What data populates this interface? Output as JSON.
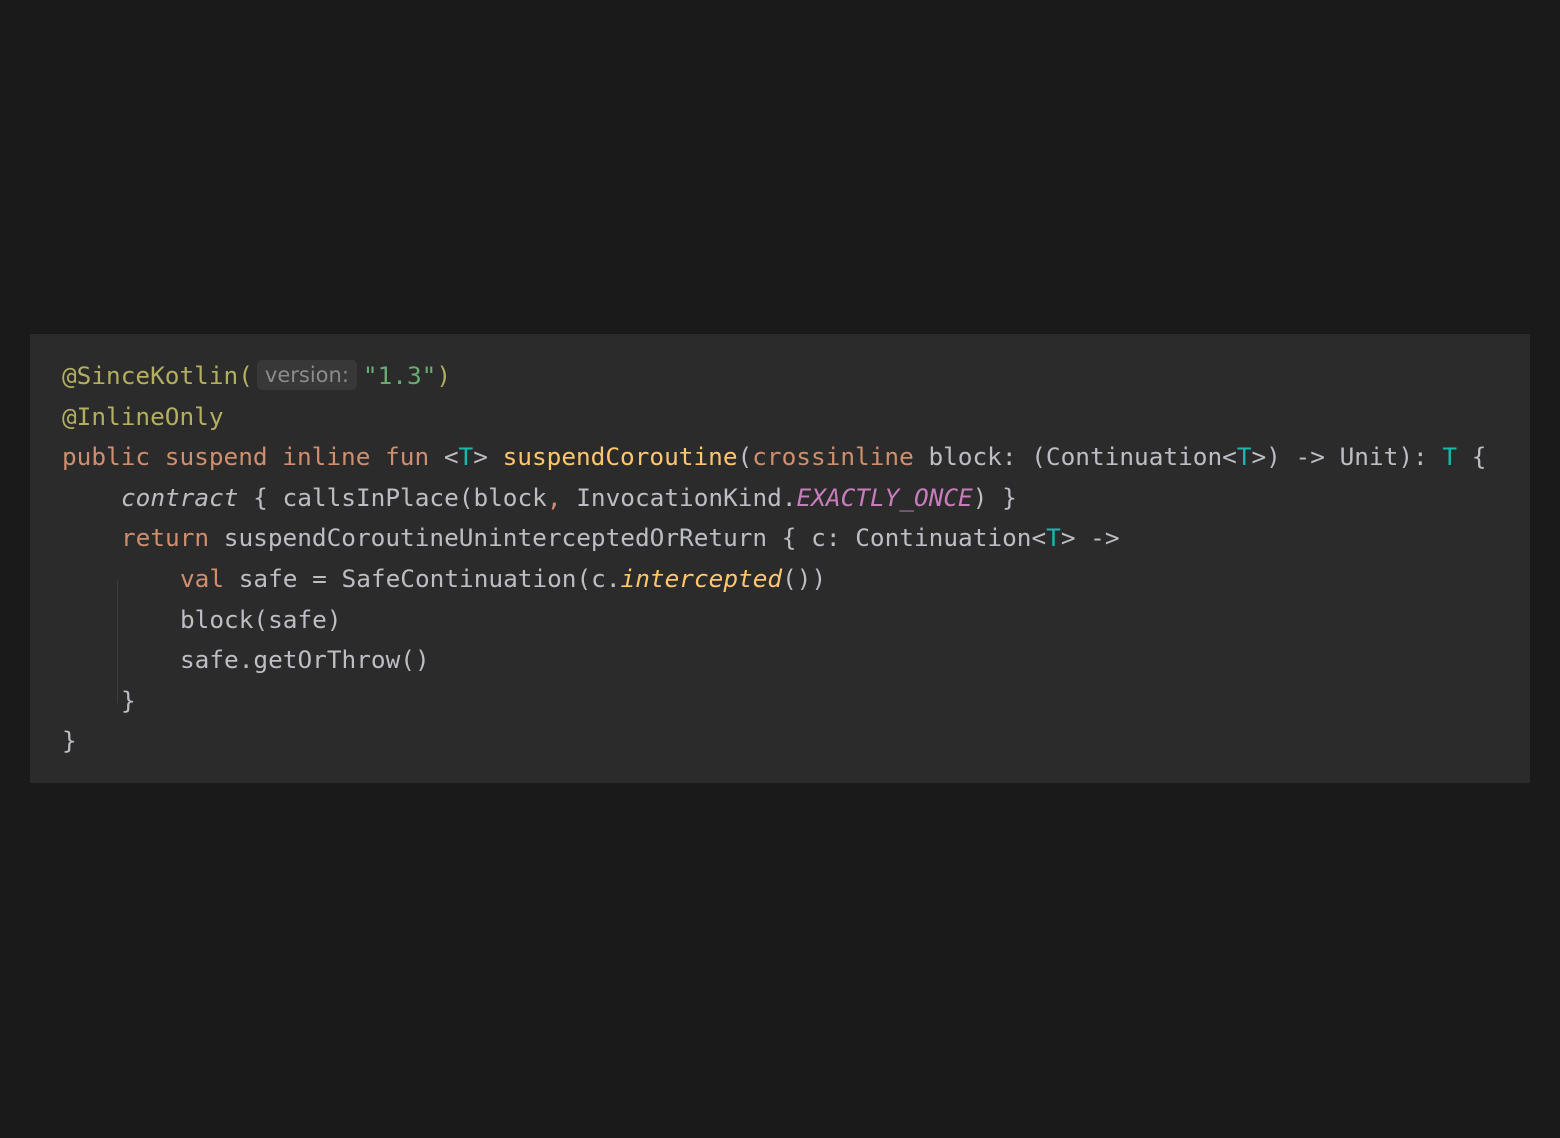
{
  "colors": {
    "background": "#1a1a1a",
    "panel": "#2b2b2b",
    "annotation": "#b3ae60",
    "keyword": "#cf8e6d",
    "type_param": "#16baac",
    "function": "#ffc66d",
    "string": "#6aab73",
    "constant": "#c77dbb",
    "default_text": "#bcbec4"
  },
  "code": {
    "l1": {
      "annotation": "@SinceKotlin(",
      "hint": "version:",
      "string": "\"1.3\"",
      "close": ")"
    },
    "l2": {
      "annotation": "@InlineOnly"
    },
    "l3": {
      "kw_public": "public",
      "kw_suspend": "suspend",
      "kw_inline": "inline",
      "kw_fun": "fun",
      "lt": "<",
      "tparam": "T",
      "gt": ">",
      "fname": "suspendCoroutine",
      "open": "(",
      "kw_crossinline": "crossinline",
      "rest1": "block: (Continuation<",
      "tparam2": "T",
      "rest2": ">) -> Unit): ",
      "ret_type": "T",
      "brace": "{"
    },
    "l4": {
      "contract": "contract",
      "mid": "{ callsInPlace(block",
      "comma": ",",
      "kind": "InvocationKind.",
      "const": "EXACTLY_ONCE",
      "end": ") }"
    },
    "l5": {
      "kw_return": "return",
      "mid": "suspendCoroutineUninterceptedOrReturn { c: Continuation<",
      "tparam": "T",
      "end": "> ->"
    },
    "l6": {
      "kw_val": "val",
      "mid": "safe = SafeContinuation(c.",
      "fn": "intercepted",
      "end": "())"
    },
    "l7": "block(safe)",
    "l8": "safe.getOrThrow()",
    "l9": "}",
    "l10": "}"
  }
}
